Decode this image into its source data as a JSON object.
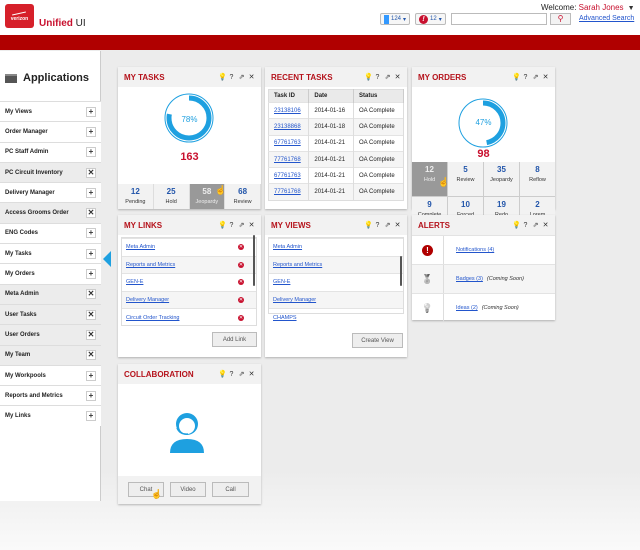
{
  "header": {
    "logo_text": "verizon",
    "brand_bold": "Unified",
    "brand_rest": " UI",
    "welcome_label": "Welcome: ",
    "user_name": "Sarah Jones",
    "docs_count": "124",
    "alerts_count": "12",
    "search_value": "",
    "advanced_search": "Advanced Search"
  },
  "sidebar": {
    "title": "Applications",
    "items": [
      {
        "label": "My Views",
        "state": "add"
      },
      {
        "label": "Order Manager",
        "state": "add"
      },
      {
        "label": "PC Staff Admin",
        "state": "add"
      },
      {
        "label": "PC Circuit Inventory",
        "state": "remove"
      },
      {
        "label": "Delivery Manager",
        "state": "add"
      },
      {
        "label": "Access Grooms Order",
        "state": "remove"
      },
      {
        "label": "ENG Codes",
        "state": "add"
      },
      {
        "label": "My Tasks",
        "state": "add"
      },
      {
        "label": "My Orders",
        "state": "add"
      },
      {
        "label": "Meta Admin",
        "state": "remove"
      },
      {
        "label": "User Tasks",
        "state": "remove"
      },
      {
        "label": "User Orders",
        "state": "remove"
      },
      {
        "label": "My Team",
        "state": "remove"
      },
      {
        "label": "My Workpools",
        "state": "add"
      },
      {
        "label": "Reports and Metrics",
        "state": "add"
      },
      {
        "label": "My Links",
        "state": "add"
      }
    ]
  },
  "glyphs": {
    "add": "+",
    "remove": "✕"
  },
  "my_tasks": {
    "title": "MY TASKS",
    "percent": 78,
    "percent_label": "78%",
    "total": "163",
    "stats": [
      {
        "n": "12",
        "l": "Pending"
      },
      {
        "n": "25",
        "l": "Hold"
      },
      {
        "n": "58",
        "l": "Jeopardy",
        "selected": true
      },
      {
        "n": "68",
        "l": "Review"
      }
    ]
  },
  "recent_tasks": {
    "title": "RECENT TASKS",
    "columns": [
      "Task ID",
      "Date",
      "Status"
    ],
    "rows": [
      [
        "23138106",
        "2014-01-16",
        "OA Complete"
      ],
      [
        "23138868",
        "2014-01-18",
        "OA Complete"
      ],
      [
        "67761763",
        "2014-01-21",
        "OA Complete"
      ],
      [
        "77761768",
        "2014-01-21",
        "OA Complete"
      ],
      [
        "67761763",
        "2014-01-21",
        "OA Complete"
      ],
      [
        "77761768",
        "2014-01-21",
        "OA Complete"
      ]
    ]
  },
  "my_orders": {
    "title": "MY ORDERS",
    "percent": 47,
    "percent_label": "47%",
    "total": "98",
    "stats": [
      {
        "n": "12",
        "l": "Hold",
        "selected": true
      },
      {
        "n": "5",
        "l": "Review"
      },
      {
        "n": "35",
        "l": "Jeopardy"
      },
      {
        "n": "8",
        "l": "Reflow"
      },
      {
        "n": "9",
        "l": "Complete"
      },
      {
        "n": "10",
        "l": "Forced Complete"
      },
      {
        "n": "19",
        "l": "Redo"
      },
      {
        "n": "2",
        "l": "Lorem"
      }
    ]
  },
  "my_links": {
    "title": "MY LINKS",
    "items": [
      "Meta Admin",
      "Reports and Metrics",
      "GEN-E",
      "Delivery Manager",
      "Circuit Order Tracking"
    ],
    "button": "Add Link"
  },
  "my_views": {
    "title": "MY VIEWS",
    "items": [
      "Meta Admin",
      "Reports and Metrics",
      "GEN-E",
      "Delivery Manager",
      "CHAMPS"
    ],
    "button": "Create View"
  },
  "alerts": {
    "title": "ALERTS",
    "items": [
      {
        "icon": "!",
        "label": "Notifications (4)",
        "note": ""
      },
      {
        "icon": "🏅",
        "label": "Badges (3)",
        "note": "(Coming Soon)"
      },
      {
        "icon": "💡",
        "label": "Ideas (2)",
        "note": "(Coming Soon)"
      }
    ]
  },
  "collaboration": {
    "title": "COLLABORATION",
    "buttons": [
      "Chat",
      "Video",
      "Call"
    ]
  },
  "tools": [
    "💡",
    "?",
    "⇗",
    "✕"
  ],
  "colors": {
    "accent": "#b5121b",
    "ring": "#1ea0e0",
    "brand_bar": "#b00000"
  }
}
